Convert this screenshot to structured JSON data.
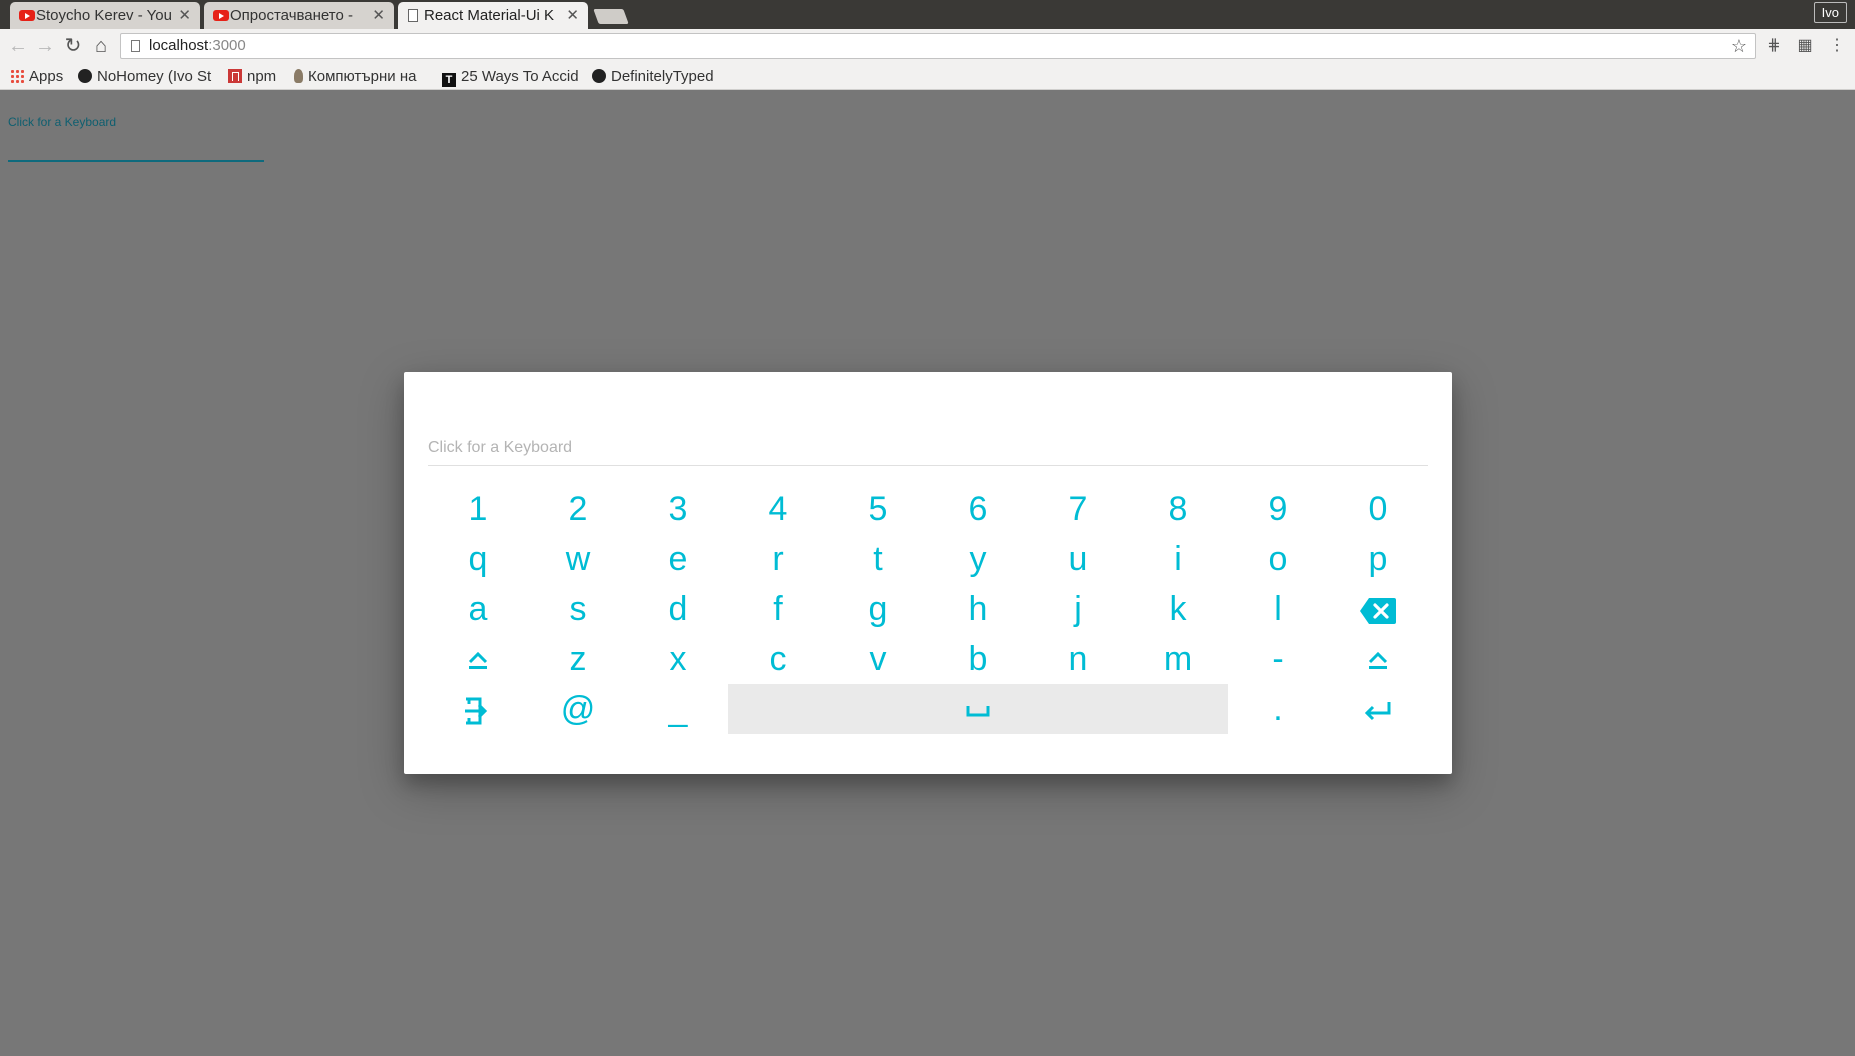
{
  "browser": {
    "tabs": [
      {
        "title": "Stoycho Kerev - You",
        "icon": "youtube-icon",
        "active": false
      },
      {
        "title": "Опростачването -",
        "icon": "youtube-icon",
        "active": false
      },
      {
        "title": "React Material-Ui K",
        "icon": "document-icon",
        "active": true
      }
    ],
    "profile_name": "Ivo",
    "url_host": "localhost",
    "url_port": ":3000",
    "bookmarks": [
      {
        "label": "Apps",
        "icon": "apps-grid-icon"
      },
      {
        "label": "NoHomey (Ivo St",
        "icon": "github-icon"
      },
      {
        "label": "npm",
        "icon": "npm-icon"
      },
      {
        "label": "Компютърни на",
        "icon": "bulb-icon"
      },
      {
        "label": "25 Ways To Accid",
        "icon": "t-icon"
      },
      {
        "label": "DefinitelyTyped",
        "icon": "github-icon"
      }
    ]
  },
  "page": {
    "field_label": "Click for a Keyboard"
  },
  "dialog": {
    "placeholder": "Click for a Keyboard",
    "keyboard": {
      "row1": [
        "1",
        "2",
        "3",
        "4",
        "5",
        "6",
        "7",
        "8",
        "9",
        "0"
      ],
      "row2": [
        "q",
        "w",
        "e",
        "r",
        "t",
        "y",
        "u",
        "i",
        "o",
        "p"
      ],
      "row3": [
        "a",
        "s",
        "d",
        "f",
        "g",
        "h",
        "j",
        "k",
        "l"
      ],
      "row4": [
        "z",
        "x",
        "c",
        "v",
        "b",
        "n",
        "m",
        "-"
      ],
      "row5_at": "@",
      "row5_underscore": "_",
      "row5_space": "␣",
      "row5_dot": "."
    }
  },
  "colors": {
    "accent": "#00bcd4",
    "backdrop": "#777777"
  }
}
